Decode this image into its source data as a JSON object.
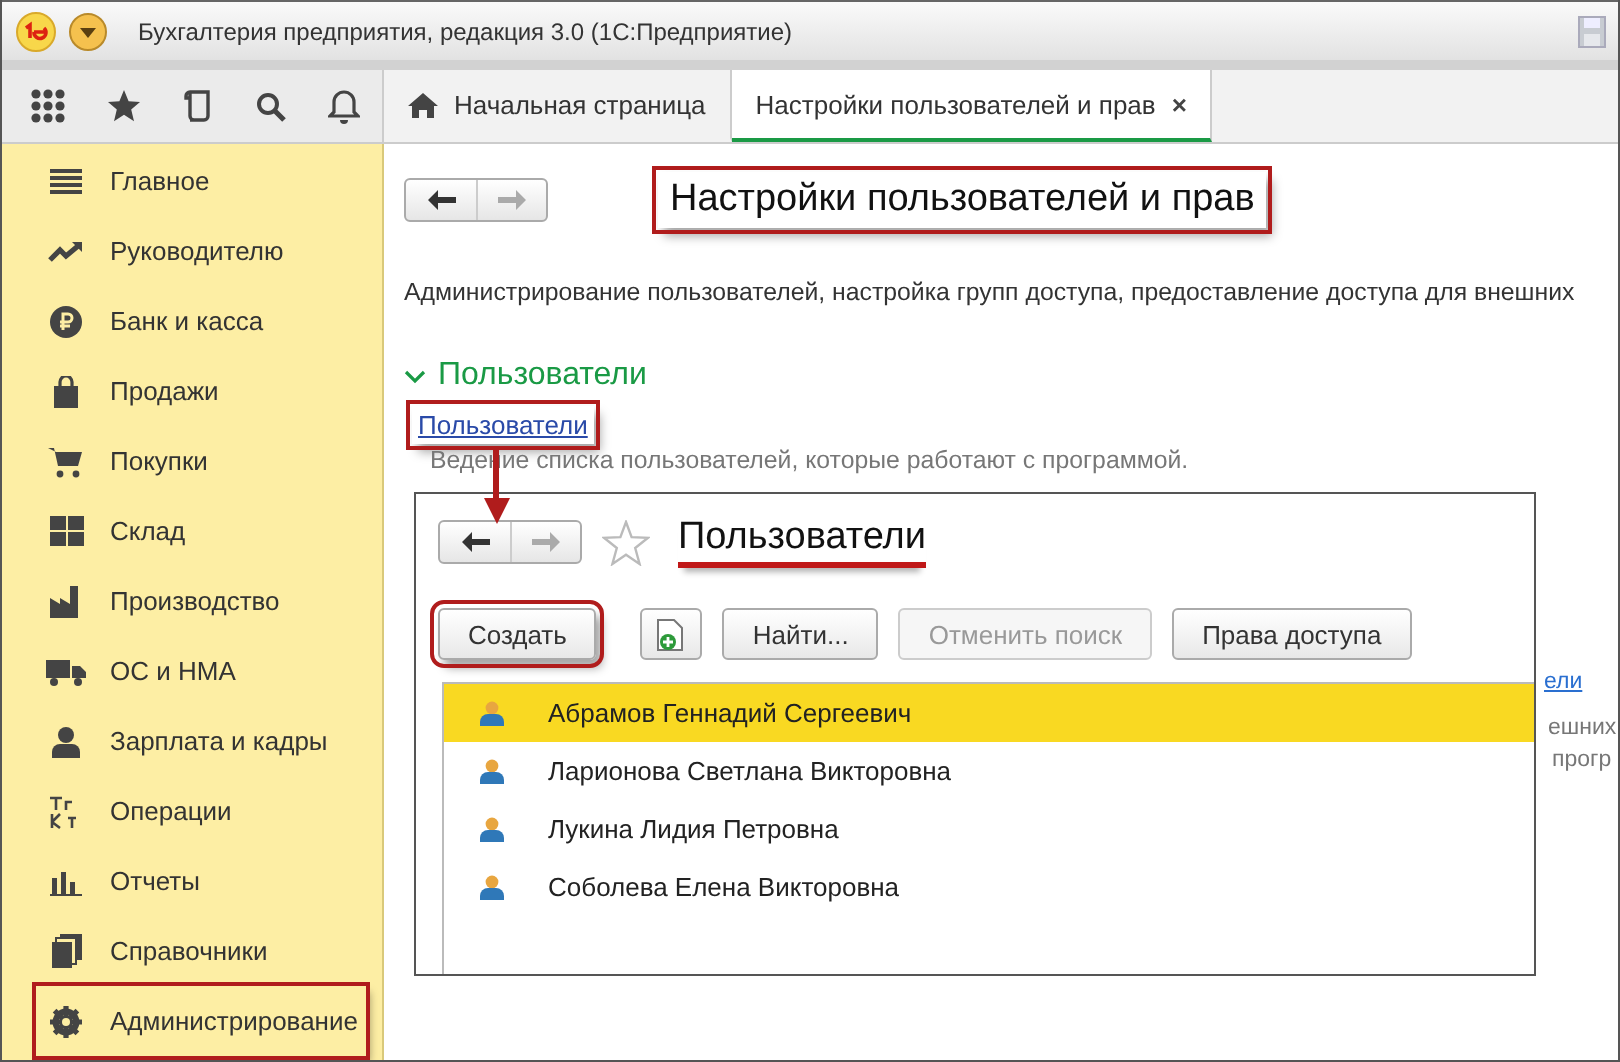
{
  "window": {
    "title": "Бухгалтерия предприятия, редакция 3.0  (1С:Предприятие)"
  },
  "tabs": [
    {
      "label": "Начальная страница",
      "selected": false,
      "kind": "home"
    },
    {
      "label": "Настройки пользователей и прав",
      "selected": true,
      "kind": "form",
      "close": "×"
    }
  ],
  "sidebar": {
    "items": [
      {
        "label": "Главное",
        "annotated": false
      },
      {
        "label": "Руководителю",
        "annotated": false
      },
      {
        "label": "Банк и касса",
        "annotated": false
      },
      {
        "label": "Продажи",
        "annotated": false
      },
      {
        "label": "Покупки",
        "annotated": false
      },
      {
        "label": "Склад",
        "annotated": false
      },
      {
        "label": "Производство",
        "annotated": false
      },
      {
        "label": "ОС и НМА",
        "annotated": false
      },
      {
        "label": "Зарплата и кадры",
        "annotated": false
      },
      {
        "label": "Операции",
        "annotated": false
      },
      {
        "label": "Отчеты",
        "annotated": false
      },
      {
        "label": "Справочники",
        "annotated": false
      },
      {
        "label": "Администрирование",
        "annotated": true
      }
    ]
  },
  "page": {
    "title": "Настройки пользователей и прав",
    "annotated": true,
    "description": "Администрирование пользователей, настройка групп доступа, предоставление доступа для внешних",
    "section": {
      "title": "Пользователи",
      "expanded": true,
      "link": {
        "label": "Пользователи",
        "annotated": true
      },
      "hint": "Ведение списка пользователей, которые работают с программой."
    },
    "covered_fragments": [
      {
        "text": "ели",
        "kind": "link"
      },
      {
        "text": "ешних",
        "kind": "text"
      },
      {
        "text": "прогр",
        "kind": "text"
      }
    ]
  },
  "users_window": {
    "title": "Пользователи",
    "underlined": true,
    "buttons": [
      {
        "kind": "text",
        "label": "Создать",
        "disabled": false,
        "annotated": true
      },
      {
        "kind": "icon",
        "disabled": false,
        "annotated": false
      },
      {
        "kind": "text",
        "label": "Найти...",
        "disabled": false,
        "annotated": false
      },
      {
        "kind": "text",
        "label": "Отменить поиск",
        "disabled": true,
        "annotated": false
      },
      {
        "kind": "text",
        "label": "Права доступа",
        "disabled": false,
        "annotated": false
      }
    ],
    "rows": [
      {
        "name": "Абрамов Геннадий Сергеевич",
        "selected": true
      },
      {
        "name": "Ларионова Светлана Викторовна",
        "selected": false
      },
      {
        "name": "Лукина Лидия Петровна",
        "selected": false
      },
      {
        "name": "Соболева Елена Викторовна",
        "selected": false
      }
    ]
  }
}
